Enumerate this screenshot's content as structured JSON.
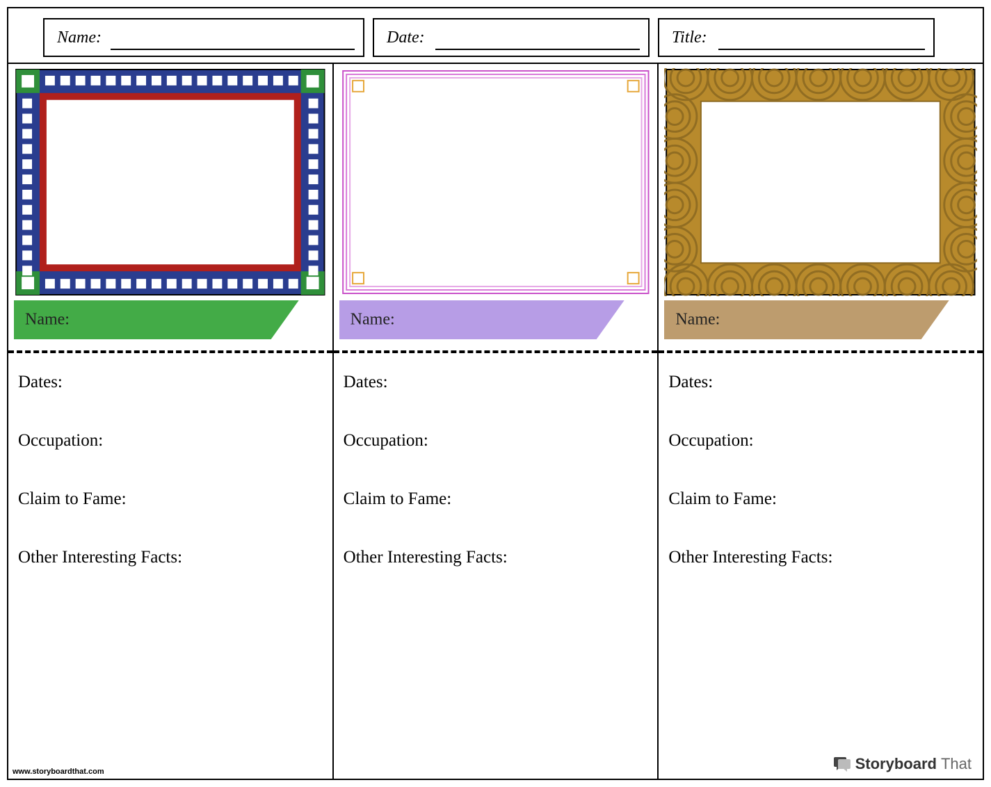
{
  "header": {
    "name_label": "Name:",
    "date_label": "Date:",
    "title_label": "Title:"
  },
  "columns": [
    {
      "banner_color": "#43ab47",
      "name_label": "Name:",
      "dates_label": "Dates:",
      "occupation_label": "Occupation:",
      "claim_label": "Claim to Fame:",
      "facts_label": "Other Interesting Facts:"
    },
    {
      "banner_color": "#b79de6",
      "name_label": "Name:",
      "dates_label": "Dates:",
      "occupation_label": "Occupation:",
      "claim_label": "Claim to Fame:",
      "facts_label": "Other Interesting Facts:"
    },
    {
      "banner_color": "#bd9c6e",
      "name_label": "Name:",
      "dates_label": "Dates:",
      "occupation_label": "Occupation:",
      "claim_label": "Claim to Fame:",
      "facts_label": "Other Interesting Facts:"
    }
  ],
  "footer": {
    "url": "www.storyboardthat.com",
    "brand_a": "Storyboard",
    "brand_b": "That"
  }
}
